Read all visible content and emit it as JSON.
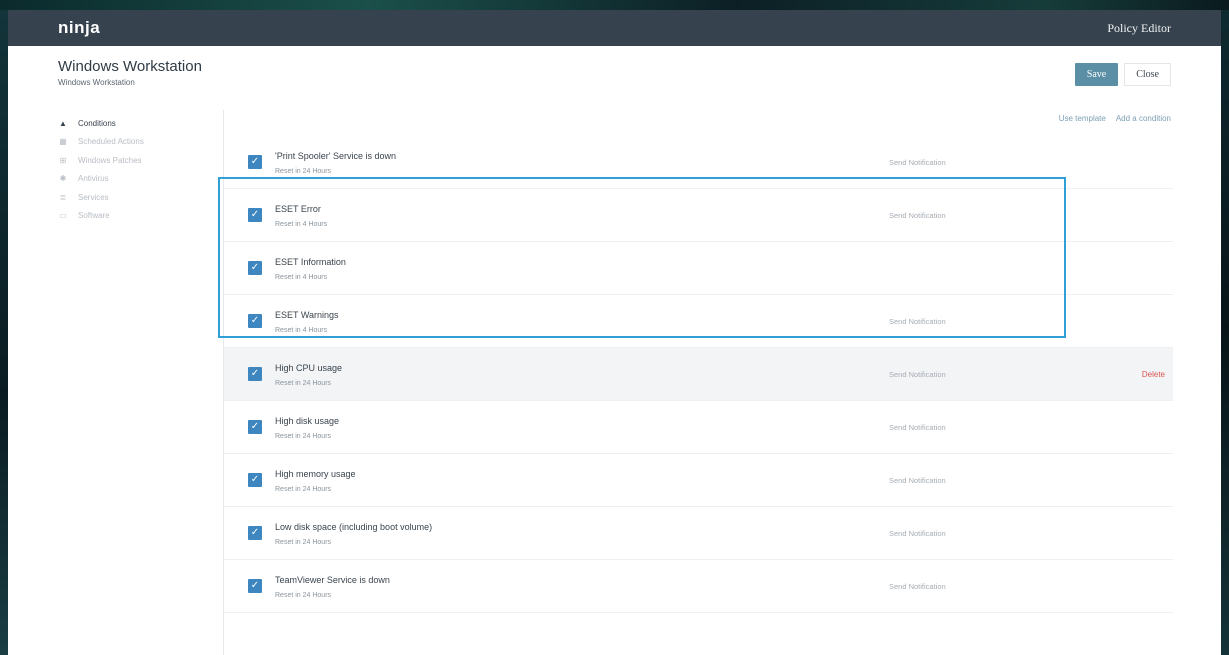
{
  "app": {
    "logo": "ninja",
    "section_title": "Policy Editor"
  },
  "header": {
    "title": "Windows Workstation",
    "subtitle": "Windows Workstation",
    "save_label": "Save",
    "close_label": "Close"
  },
  "sidebar": {
    "items": [
      {
        "label": "Conditions",
        "icon": "warning-icon"
      },
      {
        "label": "Scheduled Actions",
        "icon": "calendar-icon"
      },
      {
        "label": "Windows Patches",
        "icon": "windows-icon"
      },
      {
        "label": "Antivirus",
        "icon": "shield-icon"
      },
      {
        "label": "Services",
        "icon": "list-icon"
      },
      {
        "label": "Software",
        "icon": "window-icon"
      }
    ]
  },
  "links": {
    "use_template": "Use template",
    "add_condition": "Add a condition"
  },
  "conditions": [
    {
      "title": "'Print Spooler' Service is down",
      "reset": "Reset in 24 Hours",
      "action": "Send Notification"
    },
    {
      "title": "ESET Error",
      "reset": "Reset in 4 Hours",
      "action": "Send Notification"
    },
    {
      "title": "ESET Information",
      "reset": "Reset in 4 Hours",
      "action": ""
    },
    {
      "title": "ESET Warnings",
      "reset": "Reset in 4 Hours",
      "action": "Send Notification"
    },
    {
      "title": "High CPU usage",
      "reset": "Reset in 24 Hours",
      "action": "Send Notification",
      "delete": "Delete"
    },
    {
      "title": "High disk usage",
      "reset": "Reset in 24 Hours",
      "action": "Send Notification"
    },
    {
      "title": "High memory usage",
      "reset": "Reset in 24 Hours",
      "action": "Send Notification"
    },
    {
      "title": "Low disk space (including boot volume)",
      "reset": "Reset in 24 Hours",
      "action": "Send Notification"
    },
    {
      "title": "TeamViewer Service is down",
      "reset": "Reset in 24 Hours",
      "action": "Send Notification"
    }
  ],
  "colors": {
    "accent": "#3d86c0",
    "highlight": "#2f9fd6",
    "topbar": "#36424d",
    "delete": "#d9534f"
  }
}
